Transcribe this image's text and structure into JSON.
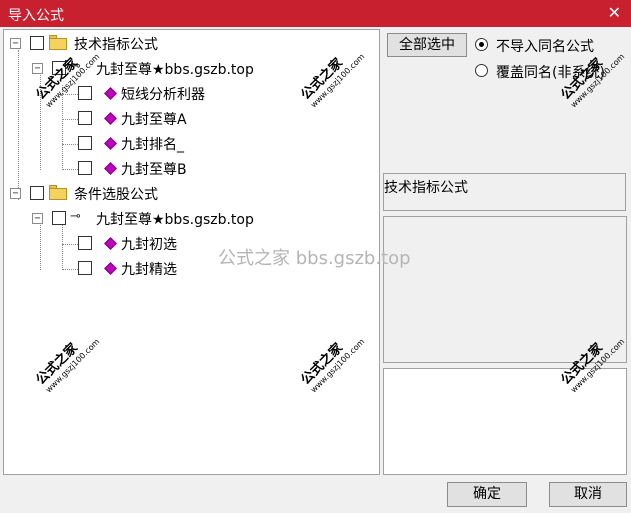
{
  "window": {
    "title": "导入公式",
    "close_glyph": "✕"
  },
  "tree": {
    "nodes": [
      {
        "label": "技术指标公式"
      },
      {
        "label": "九封至尊★bbs.gszb.top"
      },
      {
        "label": "短线分析利器"
      },
      {
        "label": "九封至尊A"
      },
      {
        "label": "九封排名_"
      },
      {
        "label": "九封至尊B"
      },
      {
        "label": "条件选股公式"
      },
      {
        "label": "九封至尊★bbs.gszb.top"
      },
      {
        "label": "九封初选"
      },
      {
        "label": "九封精选"
      }
    ]
  },
  "options": {
    "select_all_label": "全部选中",
    "radio_no_import_label": "不导入同名公式",
    "radio_overwrite_label": "覆盖同名(非系统)",
    "selected": "no_import"
  },
  "info": {
    "category_text": "技术指标公式"
  },
  "footer": {
    "ok_label": "确定",
    "cancel_label": "取消"
  },
  "watermarks": {
    "center_text": "公式之家 bbs.gszb.top",
    "stamp_title": "公式之家",
    "stamp_url": "www.gszj100.com"
  },
  "colors": {
    "titlebar": "#c8202f",
    "gem": "#c000c0",
    "folder": "#f3d25e"
  },
  "icons": [
    "close-icon",
    "folder-icon",
    "gem-icon",
    "key-icon"
  ]
}
